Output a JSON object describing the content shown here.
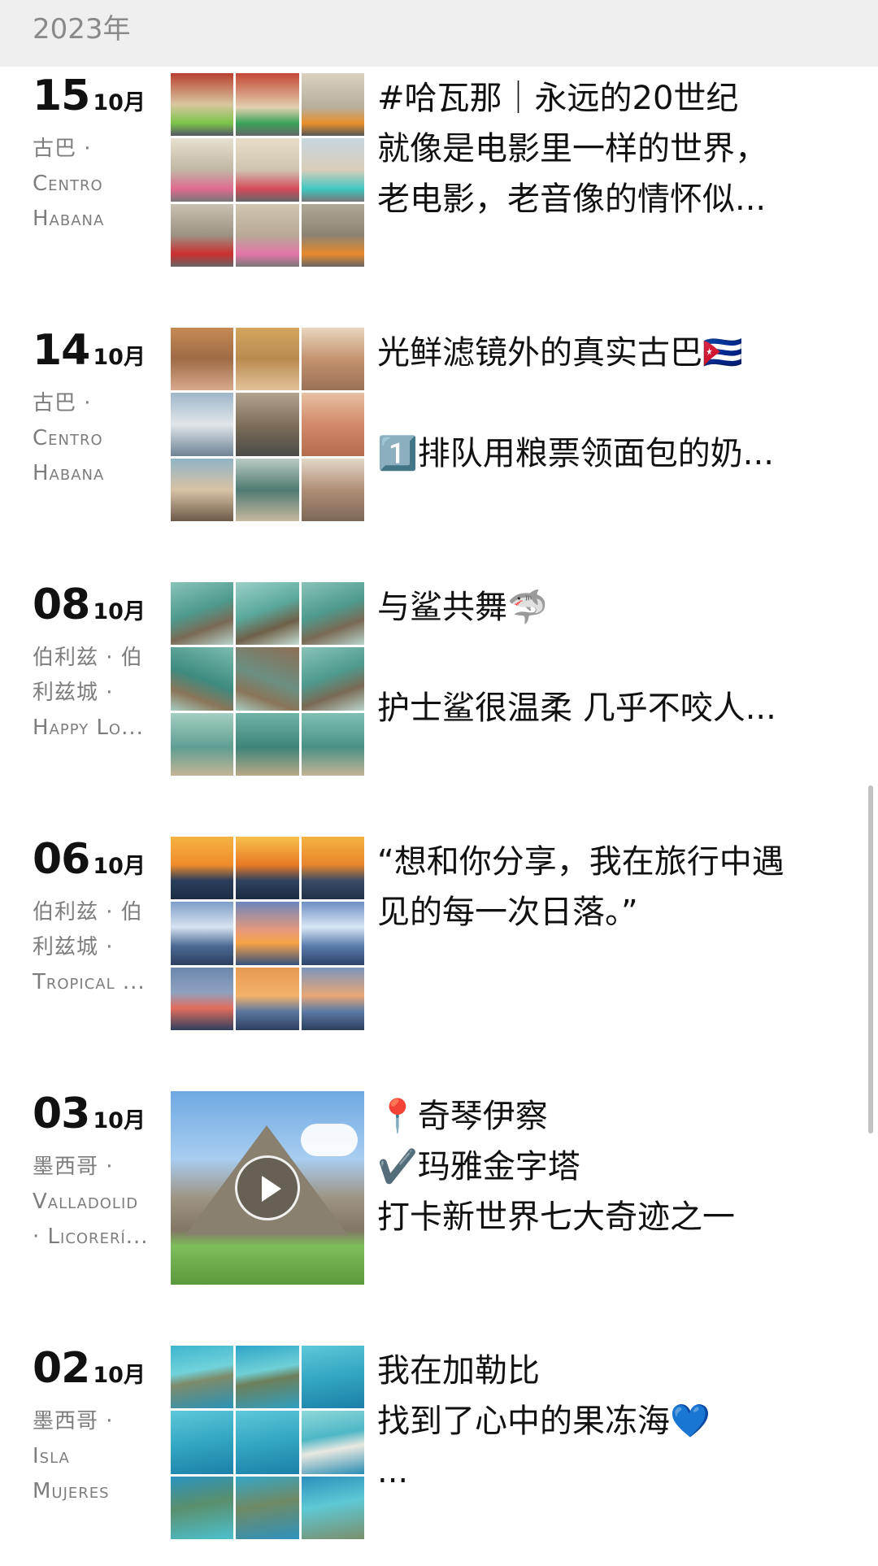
{
  "header": {
    "year": "2023年"
  },
  "posts": [
    {
      "day": "15",
      "month": "10月",
      "location": [
        "古巴 ·",
        "Centro",
        "Habana"
      ],
      "lines": [
        "#哈瓦那｜永远的20世纪",
        "就像是电影里一样的世界，",
        "老电影，老音像的情怀似..."
      ]
    },
    {
      "day": "14",
      "month": "10月",
      "location": [
        "古巴 ·",
        "Centro",
        "Habana"
      ],
      "lines": [
        "光鲜滤镜外的真实古巴🇨🇺",
        "",
        "1️⃣排队用粮票领面包的奶..."
      ]
    },
    {
      "day": "08",
      "month": "10月",
      "location": [
        "伯利兹 · 伯",
        "利兹城 ·",
        "Happy Lo..."
      ],
      "lines": [
        "与鲨共舞🦈",
        "",
        "护士鲨很温柔 几乎不咬人..."
      ]
    },
    {
      "day": "06",
      "month": "10月",
      "location": [
        "伯利兹 · 伯",
        "利兹城 ·",
        "Tropical ..."
      ],
      "lines": [
        "“想和你分享，我在旅行中遇",
        "见的每一次日落。”"
      ]
    },
    {
      "day": "03",
      "month": "10月",
      "location": [
        "墨西哥 ·",
        "Valladolid",
        "· Licorerí..."
      ],
      "lines": [
        "📍奇琴伊察",
        "✔️玛雅金字塔",
        "打卡新世界七大奇迹之一"
      ]
    },
    {
      "day": "02",
      "month": "10月",
      "location": [
        "墨西哥 ·",
        "Isla",
        "Mujeres"
      ],
      "lines": [
        "我在加勒比",
        "找到了心中的果冻海💙",
        "..."
      ]
    }
  ],
  "icons": {
    "video_play": "play-icon"
  }
}
